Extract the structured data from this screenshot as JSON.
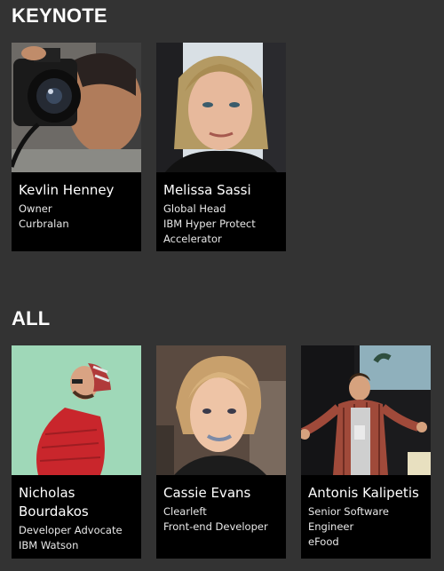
{
  "sections": {
    "keynote": {
      "title": "KEYNOTE",
      "speakers": [
        {
          "name": "Kevlin Henney",
          "role": "Owner",
          "company": "Curbralan"
        },
        {
          "name": "Melissa Sassi",
          "role": "Global Head",
          "company": "IBM Hyper Protect Accelerator"
        }
      ]
    },
    "all": {
      "title": "ALL",
      "speakers": [
        {
          "name": "Nicholas Bourdakos",
          "role": "Developer Advocate",
          "company": "IBM Watson"
        },
        {
          "name": "Cassie Evans",
          "role": "Clearleft",
          "company": "Front-end Developer"
        },
        {
          "name": "Antonis Kalipetis",
          "role": "Senior Software Engineer",
          "company": "eFood"
        }
      ]
    }
  },
  "colors": {
    "background": "#333333",
    "card": "#000000",
    "text": "#ffffff"
  }
}
